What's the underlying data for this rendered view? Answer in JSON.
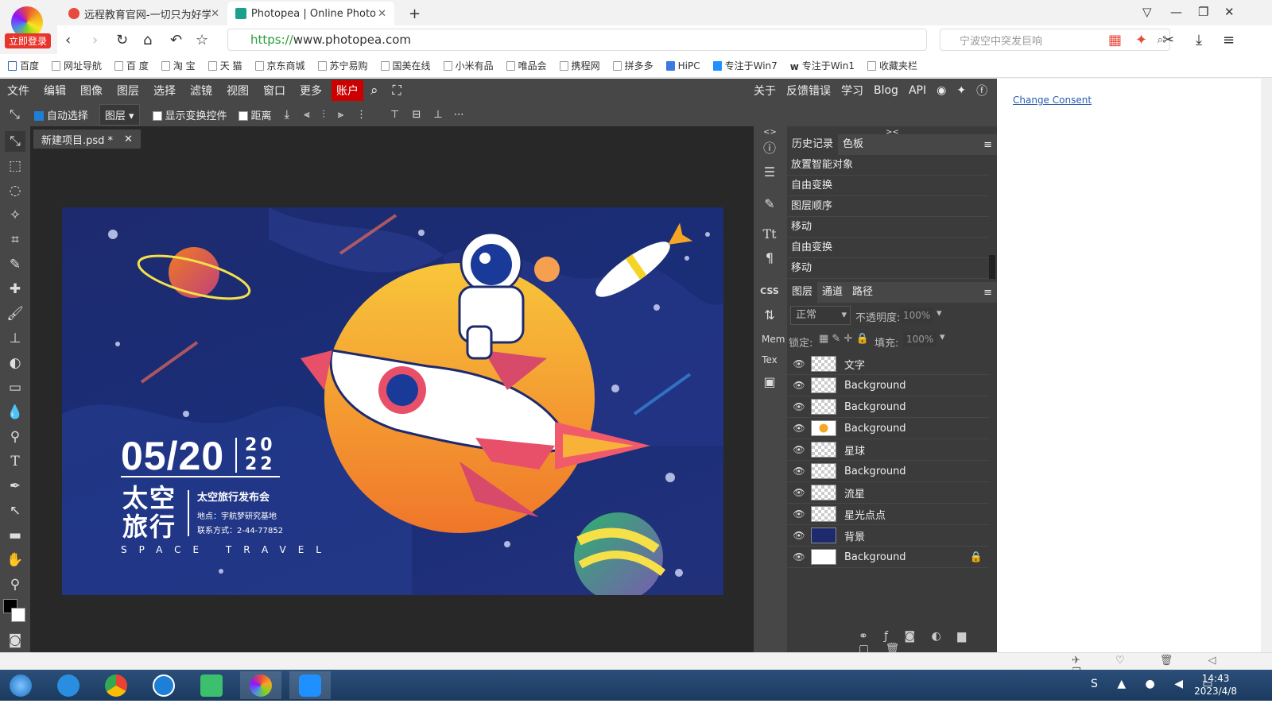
{
  "browser": {
    "login_badge": "立即登录",
    "tabs": [
      {
        "title": "远程教育官网-一切只为好学的"
      },
      {
        "title": "Photopea | Online Photo Ed"
      }
    ],
    "url_scheme": "https://",
    "url_host": "www.photopea.com",
    "search_placeholder": "宁波空中突发巨响",
    "bookmarks": [
      "百度",
      "网址导航",
      "百 度",
      "淘 宝",
      "天 猫",
      "京东商城",
      "苏宁易购",
      "国美在线",
      "小米有品",
      "唯品会",
      "携程网",
      "拼多多",
      "HiPC",
      "专注于Win7",
      "专注于Win1",
      "收藏夹栏"
    ]
  },
  "photopea": {
    "menu": [
      "文件",
      "编辑",
      "图像",
      "图层",
      "选择",
      "滤镜",
      "视图",
      "窗口",
      "更多"
    ],
    "account": "账户",
    "right_menu": [
      "关于",
      "反馈错误",
      "学习",
      "Blog",
      "API"
    ],
    "options": {
      "auto_select": "自动选择",
      "layer_select": "图层",
      "show_transform": "显示变换控件",
      "distance": "距离"
    },
    "doc_tab": "新建项目.psd *",
    "canvas": {
      "date": "05/20",
      "year_top": "20",
      "year_bottom": "22",
      "title_line1": "太空",
      "title_line2": "旅行",
      "event": "太空旅行发布会",
      "location": "地点：宇航梦研究基地",
      "contact": "联系方式：2-44-77852",
      "subtitle": "SPACE TRAVEL"
    },
    "side_labels": {
      "css": "CSS",
      "mem": "Mem",
      "tex": "Tex"
    },
    "history": {
      "tabs": [
        "历史记录",
        "色板"
      ],
      "items": [
        "放置智能对象",
        "自由变换",
        "图层顺序",
        "移动",
        "自由变换",
        "移动"
      ]
    },
    "layers_panel": {
      "tabs": [
        "图层",
        "通道",
        "路径"
      ],
      "blend_mode": "正常",
      "opacity_label": "不透明度:",
      "opacity": "100%",
      "lock_label": "锁定:",
      "fill_label": "填充:",
      "fill": "100%",
      "layers": [
        "文字",
        "Background",
        "Background",
        "Background",
        "星球",
        "Background",
        "流星",
        "星光点点",
        "背景",
        "Background"
      ]
    },
    "consent": "Change Consent"
  },
  "taskbar": {
    "time": "14:43",
    "date": "2023/4/8"
  },
  "colors": {
    "account_red": "#cc0000",
    "panel_bg": "#474747",
    "canvas_bg": "#1e2a6e",
    "planet_orange": "#f5a623"
  }
}
